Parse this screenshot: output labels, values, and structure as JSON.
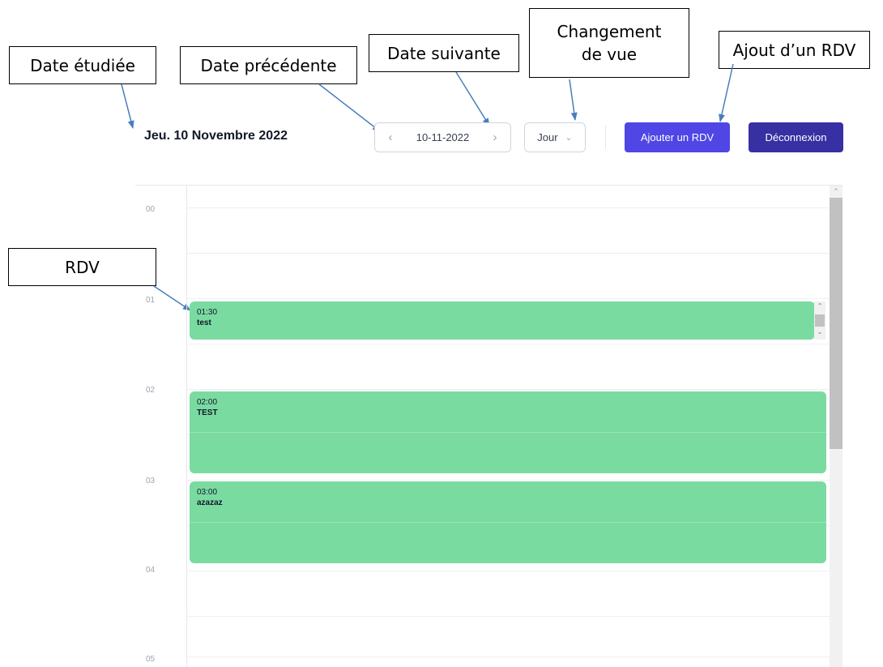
{
  "annotations": {
    "date_etudiee": "Date étudiée",
    "date_precedente": "Date précédente",
    "date_suivante": "Date suivante",
    "changement_vue_line1": "Changement",
    "changement_vue_line2": "de vue",
    "ajout_rdv": "Ajout d’un RDV",
    "rdv": "RDV"
  },
  "header": {
    "date_title": "Jeu. 10 Novembre 2022",
    "current_date": "10-11-2022",
    "view_mode": "Jour",
    "add_button": "Ajouter un RDV",
    "logout_button": "Déconnexion"
  },
  "hours": [
    "00",
    "01",
    "02",
    "03",
    "04",
    "05"
  ],
  "events": [
    {
      "time": "01:30",
      "title": "test"
    },
    {
      "time": "02:00",
      "title": "TEST"
    },
    {
      "time": "03:00",
      "title": "azazaz"
    }
  ],
  "icons": {
    "prev": "chevron-left-icon",
    "next": "chevron-right-icon",
    "view_dropdown": "chevron-down-icon"
  },
  "colors": {
    "event_bg": "#7adba1",
    "add_button_bg": "#4f46e5",
    "logout_button_bg": "#3730a3",
    "arrow": "#4a7ebb"
  }
}
